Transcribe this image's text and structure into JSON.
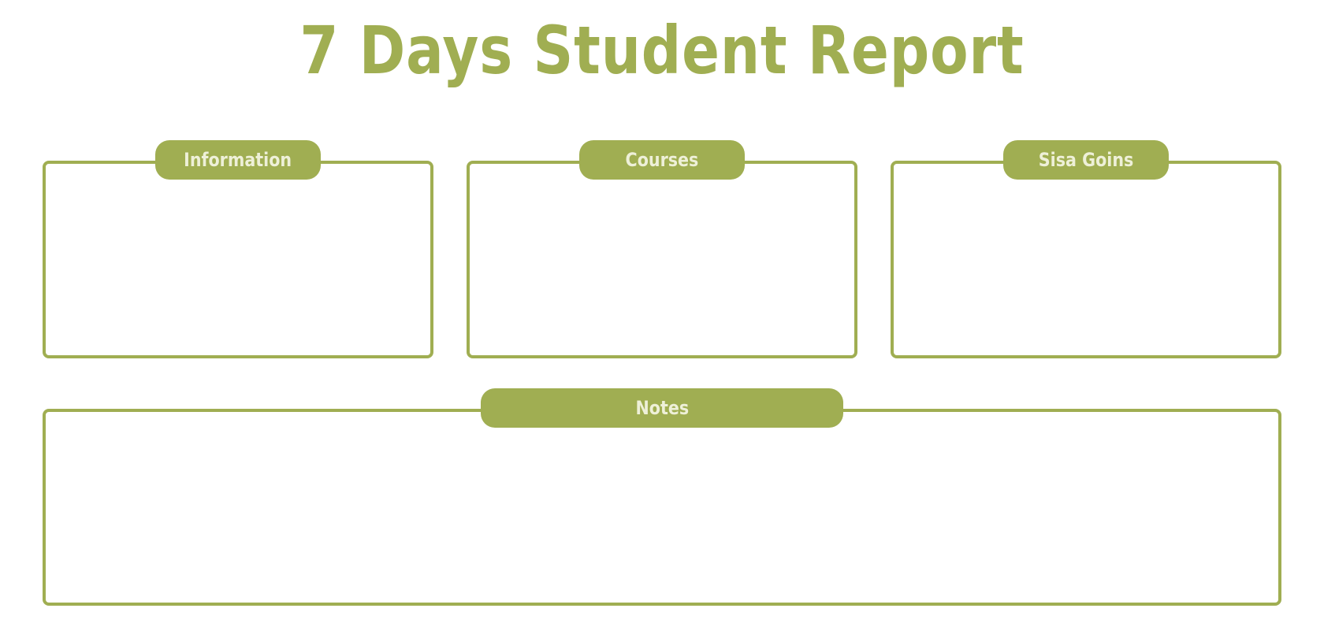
{
  "header": {
    "title": "7 Days Student Report"
  },
  "panels": {
    "information": {
      "label": "Information"
    },
    "courses": {
      "label": "Courses"
    },
    "student": {
      "label": "Sisa Goins"
    },
    "notes": {
      "label": "Notes"
    }
  },
  "colors": {
    "accent": "#a0ae52",
    "tab_text": "#eef0d8",
    "background": "#ffffff"
  }
}
